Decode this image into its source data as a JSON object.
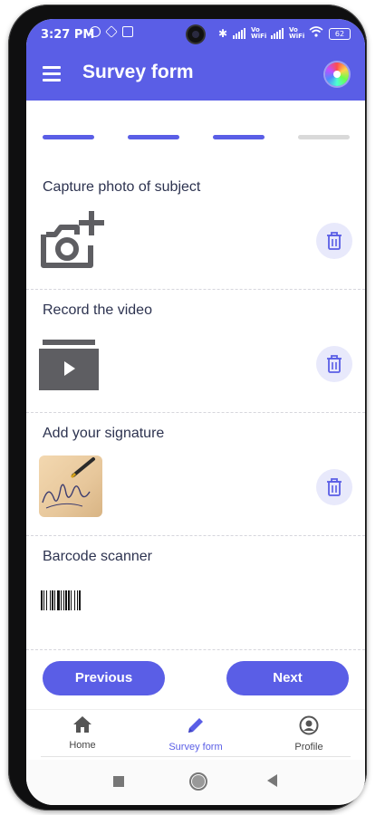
{
  "status_bar": {
    "time": "3:27 PM",
    "battery": "62",
    "vowifi_label_1": "Vo WiFi",
    "vowifi_label_2": "Vo WiFi"
  },
  "app_bar": {
    "title": "Survey form",
    "menu_icon": "hamburger-menu-icon",
    "profile_icon": "color-wheel-icon"
  },
  "progress": {
    "total_steps": 4,
    "completed_steps": 3,
    "active_color": "#5a5ee6",
    "inactive_color": "#d9d9d9"
  },
  "sections": [
    {
      "title": "Capture photo of subject",
      "icon": "add-photo-camera-icon",
      "has_delete": true
    },
    {
      "title": "Record the video",
      "icon": "video-folder-icon",
      "has_delete": true
    },
    {
      "title": "Add your signature",
      "icon": "signature-image",
      "has_delete": true
    },
    {
      "title": "Barcode scanner",
      "icon": "barcode-image",
      "has_delete": false
    }
  ],
  "buttons": {
    "previous": "Previous",
    "next": "Next"
  },
  "bottom_nav": {
    "items": [
      {
        "label": "Home",
        "icon": "home-icon"
      },
      {
        "label": "Survey form",
        "icon": "pencil-icon",
        "active": true
      },
      {
        "label": "Profile",
        "icon": "profile-icon"
      }
    ]
  },
  "colors": {
    "primary": "#5a5ee6",
    "text": "#2d3350",
    "trash_bg": "#e8e9fb"
  }
}
